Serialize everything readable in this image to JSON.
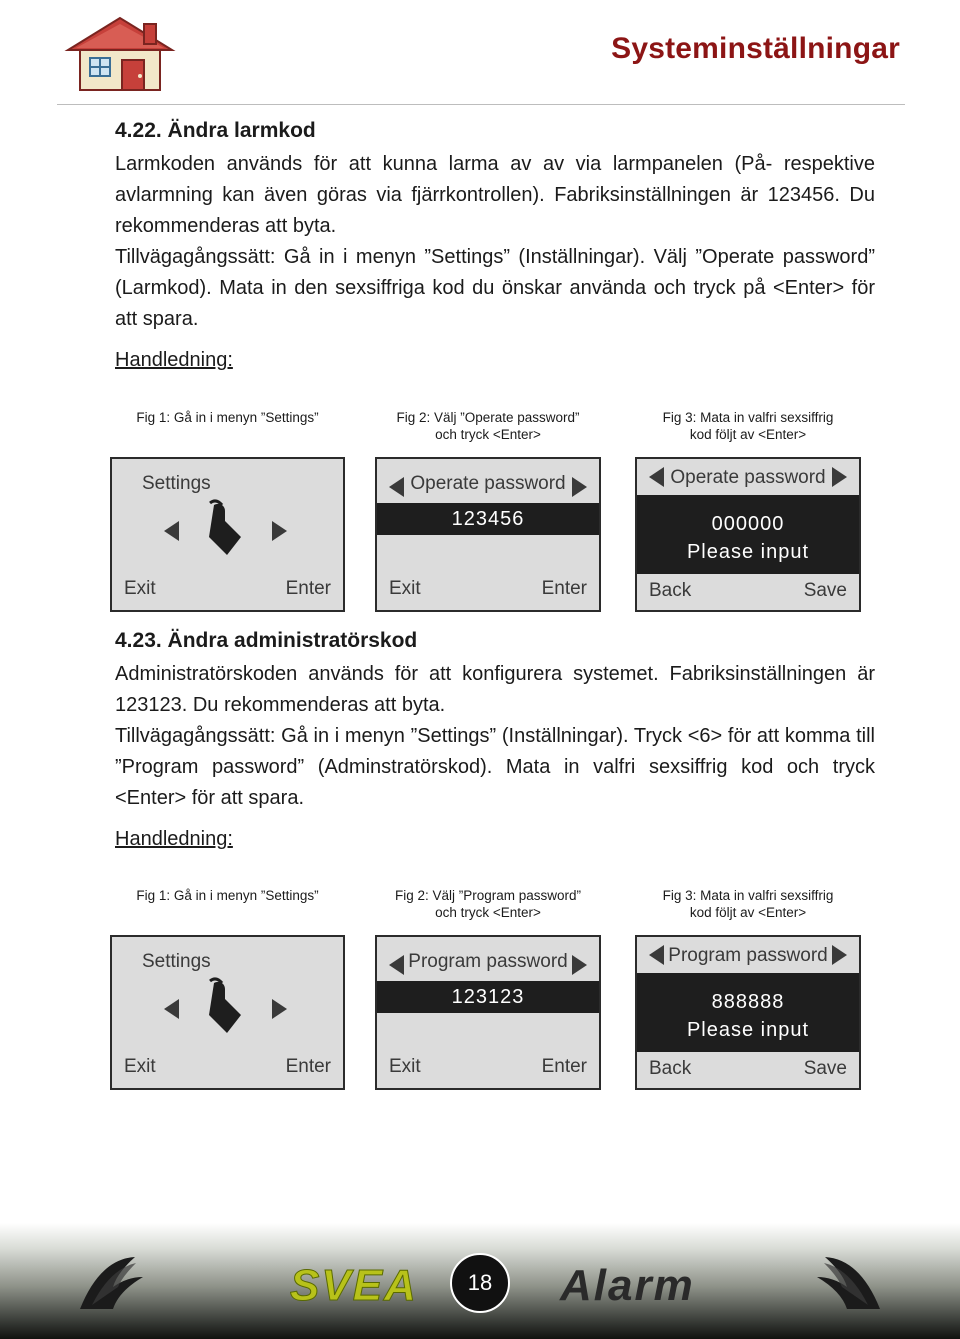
{
  "header": {
    "title": "Systeminställningar",
    "logo_icon": "house-logo-icon"
  },
  "sections": [
    {
      "id": "s422",
      "title": "4.22. Ändra larmkod",
      "paragraphs": [
        "Larmkoden används för att kunna larma av av via larmpanelen (På- respektive avlarmning kan även göras via fjärrkontrollen). Fabriksinställningen är 123456. Du rekommenderas att byta.",
        "Tillvägagångssätt: Gå in i menyn ”Settings” (Inställningar). Välj ”Operate password” (Larmkod). Mata in den sexsiffriga kod du önskar använda och tryck på <Enter> för att spara."
      ],
      "para_underlined_lead": "Tillvägagångssätt",
      "handledning_label": "Handledning:",
      "figures": [
        {
          "caption": "Fig 1: Gå in i menyn ”Settings”",
          "title": "Settings",
          "left_btn": "Exit",
          "right_btn": "Enter",
          "icon": "hand-pointer-icon"
        },
        {
          "caption_line1": "Fig 2: Välj ”Operate password”",
          "caption_line2": "och tryck <Enter>",
          "title": "Operate password",
          "code": "123456",
          "left_btn": "Exit",
          "right_btn": "Enter"
        },
        {
          "caption_line1": "Fig 3: Mata in valfri sexsiffrig",
          "caption_line2": "kod följt av <Enter>",
          "title": "Operate password",
          "code": "000000",
          "prompt": "Please  input",
          "left_btn": "Back",
          "right_btn": "Save"
        }
      ]
    },
    {
      "id": "s423",
      "title": "4.23. Ändra administratörskod",
      "paragraphs": [
        "Administratörskoden används för att konfigurera systemet. Fabriksinställningen är 123123. Du rekommenderas att byta.",
        "Tillvägagångssätt: Gå in i menyn ”Settings” (Inställningar). Tryck <6> för att komma till ”Program password” (Adminstratörskod). Mata in valfri sexsiffrig kod och tryck <Enter> för att spara."
      ],
      "handledning_label": "Handledning:",
      "figures": [
        {
          "caption": "Fig 1: Gå in i menyn ”Settings”",
          "title": "Settings",
          "left_btn": "Exit",
          "right_btn": "Enter",
          "icon": "hand-pointer-icon"
        },
        {
          "caption_line1": "Fig 2: Välj ”Program password”",
          "caption_line2": "och tryck <Enter>",
          "title": "Program password",
          "code": "123123",
          "left_btn": "Exit",
          "right_btn": "Enter"
        },
        {
          "caption_line1": "Fig 3: Mata in valfri sexsiffrig",
          "caption_line2": "kod följt av <Enter>",
          "title": "Program password",
          "code": "888888",
          "prompt": "Please  input",
          "left_btn": "Back",
          "right_btn": "Save"
        }
      ]
    }
  ],
  "footer": {
    "page_number": "18",
    "brand_left": "SVEA",
    "brand_right": "Alarm",
    "bird_icon": "bird-logo-icon"
  },
  "colors": {
    "title_red": "#8c1515",
    "lcd_bg": "#dcdcdc",
    "lcd_dark": "#1e1e1e",
    "svea_green": "#b8c21a"
  }
}
